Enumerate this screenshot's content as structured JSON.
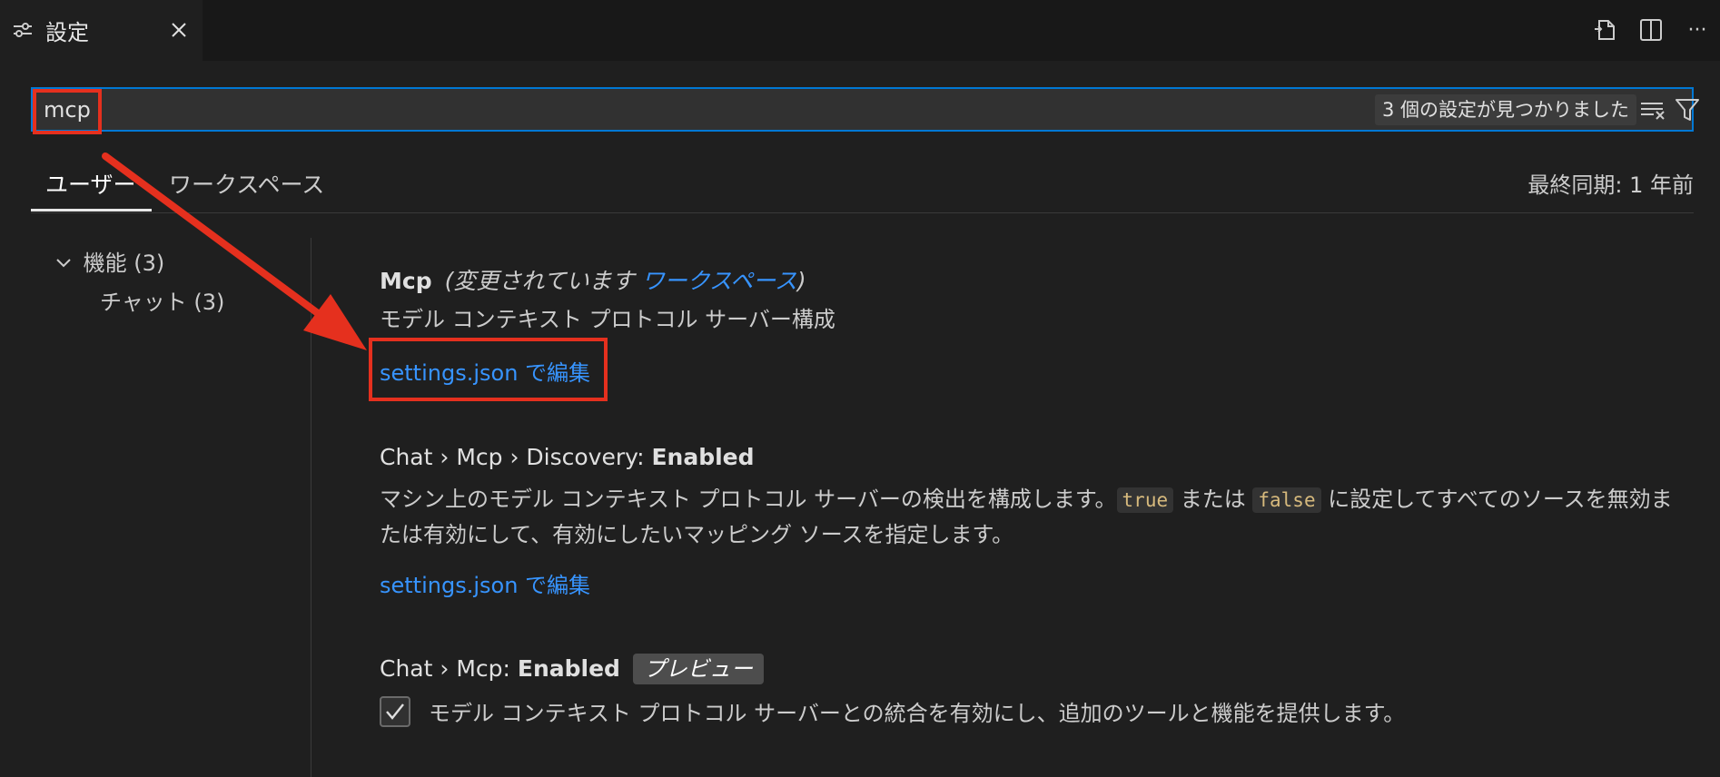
{
  "tab": {
    "title": "設定",
    "icon": "settings-sliders-icon",
    "close_icon": "close-icon"
  },
  "toolbar": {
    "icons": [
      "open-settings-json-icon",
      "split-editor-icon",
      "more-actions-icon"
    ],
    "more_glyph": "···"
  },
  "search": {
    "value": "mcp",
    "result_count": "3 個の設定が見つかりました",
    "clear_icon": "clear-filter-icon",
    "filter_icon": "filter-icon"
  },
  "scope_tabs": {
    "user": "ユーザー",
    "workspace": "ワークスペース",
    "last_sync": "最終同期: 1 年前"
  },
  "tree": {
    "group": "機能 (3)",
    "child": "チャット (3)"
  },
  "settings": [
    {
      "title": "Mcp",
      "modified_prefix": "(変更されています",
      "modified_link": "ワークスペース",
      "modified_suffix": ")",
      "description": "モデル コンテキスト プロトコル サーバー構成",
      "edit_link": "settings.json で編集"
    },
    {
      "title_prefix": "Chat › Mcp › Discovery: ",
      "title_bold": "Enabled",
      "desc_part1": "マシン上のモデル コンテキスト プロトコル サーバーの検出を構成します。",
      "code1": "true",
      "desc_part2": " または ",
      "code2": "false",
      "desc_part3": " に設定してすべてのソースを無効または有効にして、有効にしたいマッピング ソースを指定します。",
      "edit_link": "settings.json で編集"
    },
    {
      "title_prefix": "Chat › Mcp: ",
      "title_bold": "Enabled",
      "badge": "プレビュー",
      "checkbox_checked": true,
      "checkbox_label": "モデル コンテキスト プロトコル サーバーとの統合を有効にし、追加のツールと機能を提供します。"
    }
  ],
  "colors": {
    "accent": "#0078d4",
    "link": "#3794ff",
    "annotation": "#e5301e"
  }
}
